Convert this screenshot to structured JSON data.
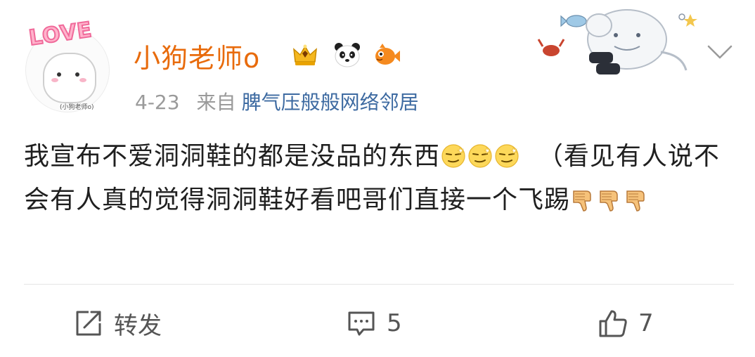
{
  "user": {
    "name": "小狗老师o",
    "avatar_text": "LOVE",
    "avatar_tag": "(小狗老师o)"
  },
  "meta": {
    "date": "4-23",
    "from_label": "来自",
    "device": "脾气压般般网络邻居"
  },
  "post": {
    "line1": "我宣布不爱洞洞鞋的都是没品的东西",
    "line2": "（看见有人说不会有人真的觉得洞洞鞋好看吧哥们直接一个飞踢"
  },
  "actions": {
    "repost_label": "转发",
    "comment_count": "5",
    "like_count": "7"
  },
  "colors": {
    "username": "#e86b0c",
    "device_link": "#3d6aa1",
    "meta_gray": "#9a9a9a"
  },
  "icons": [
    "crown-badge-icon",
    "panda-badge-icon",
    "fish-badge-icon",
    "chevron-down-icon",
    "smirk-emoji-icon",
    "thumbs-down-emoji-icon",
    "repost-icon",
    "comment-icon",
    "like-icon"
  ]
}
